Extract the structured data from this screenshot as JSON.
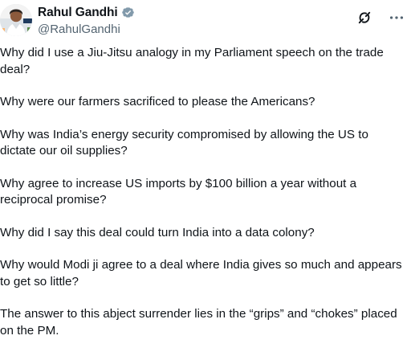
{
  "author": {
    "display_name": "Rahul Gandhi",
    "handle": "@RahulGandhi",
    "verified_badge_color": "#829aab",
    "avatar_icon": "profile-photo"
  },
  "actions": {
    "grok_icon": "grok-icon",
    "more_icon": "more-options-icon"
  },
  "tweet": {
    "paragraphs": [
      "Why did I use a Jiu-Jitsu analogy in my Parliament speech on the trade deal?",
      "Why were our farmers sacrificed to please the Americans?",
      "Why was India’s energy security compromised by allowing the US to dictate our oil supplies?",
      "Why agree to increase US imports by $100 billion a year without a reciprocal promise?",
      "Why did I say this deal could turn India into a data colony?",
      "Why would Modi ji agree to a deal where India gives so much and appears to get so little?",
      "The answer to this abject surrender lies in the “grips” and “chokes” placed on the PM."
    ]
  }
}
